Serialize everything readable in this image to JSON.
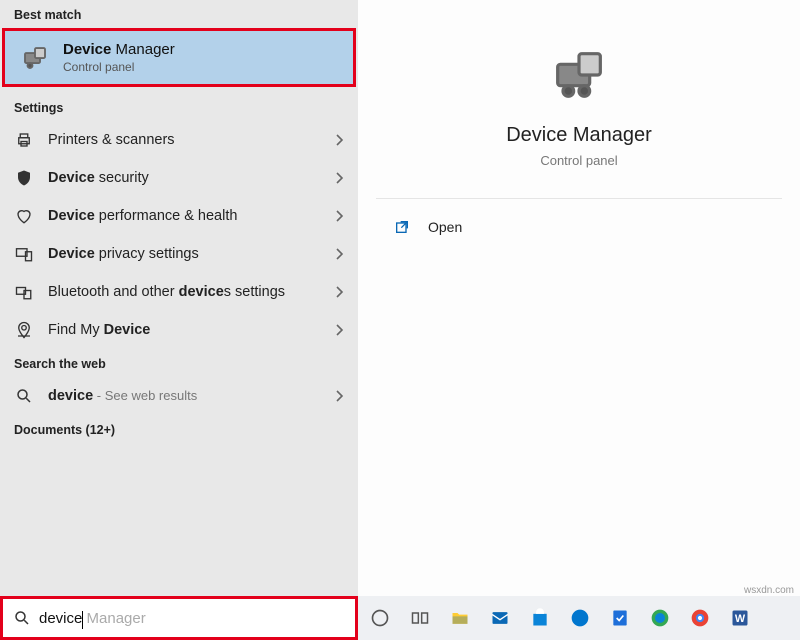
{
  "left": {
    "best_match_header": "Best match",
    "best_match": {
      "title_bold": "Device",
      "title_rest": " Manager",
      "subtitle": "Control panel"
    },
    "settings_header": "Settings",
    "settings": [
      {
        "pre": "Printers & scanners",
        "bold": "",
        "post": ""
      },
      {
        "pre": "",
        "bold": "Device",
        "post": " security"
      },
      {
        "pre": "",
        "bold": "Device",
        "post": " performance & health"
      },
      {
        "pre": "",
        "bold": "Device",
        "post": " privacy settings"
      },
      {
        "pre": "Bluetooth and other ",
        "bold": "device",
        "post": "s settings"
      },
      {
        "pre": "Find My ",
        "bold": "Device",
        "post": ""
      }
    ],
    "web_header": "Search the web",
    "web": {
      "bold": "device",
      "dim": " - See web results"
    },
    "docs_header": "Documents (12+)"
  },
  "preview": {
    "title": "Device Manager",
    "subtitle": "Control panel",
    "open": "Open"
  },
  "search": {
    "typed": "device",
    "ghost": " Manager"
  },
  "watermark": "wsxdn.com"
}
